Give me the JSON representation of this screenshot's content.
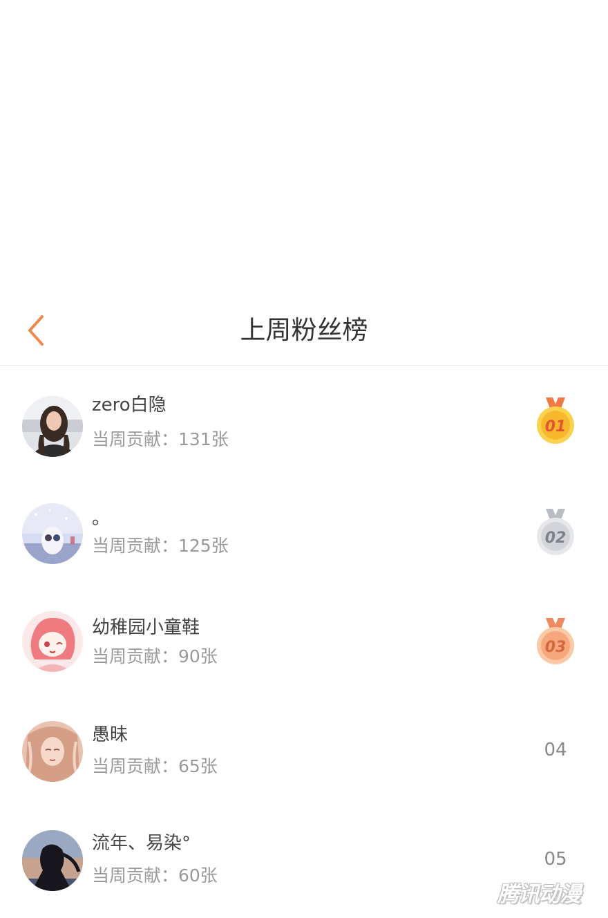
{
  "header": {
    "title": "上周粉丝榜",
    "back_icon": "chevron-left-icon",
    "accent_color": "#f08a4b"
  },
  "fans": [
    {
      "rank": "01",
      "name": "zero白隐",
      "contribution": "当周贡献：131张",
      "medal": "gold-medal-icon"
    },
    {
      "rank": "02",
      "name": "。",
      "contribution": "当周贡献：125张",
      "medal": "silver-medal-icon"
    },
    {
      "rank": "03",
      "name": "幼稚园小童鞋",
      "contribution": "当周贡献：90张",
      "medal": "bronze-medal-icon"
    },
    {
      "rank": "04",
      "name": "愚昧",
      "contribution": "当周贡献：65张"
    },
    {
      "rank": "05",
      "name": "流年、易染°",
      "contribution": "当周贡献：60张"
    }
  ],
  "watermark": "腾讯动漫"
}
